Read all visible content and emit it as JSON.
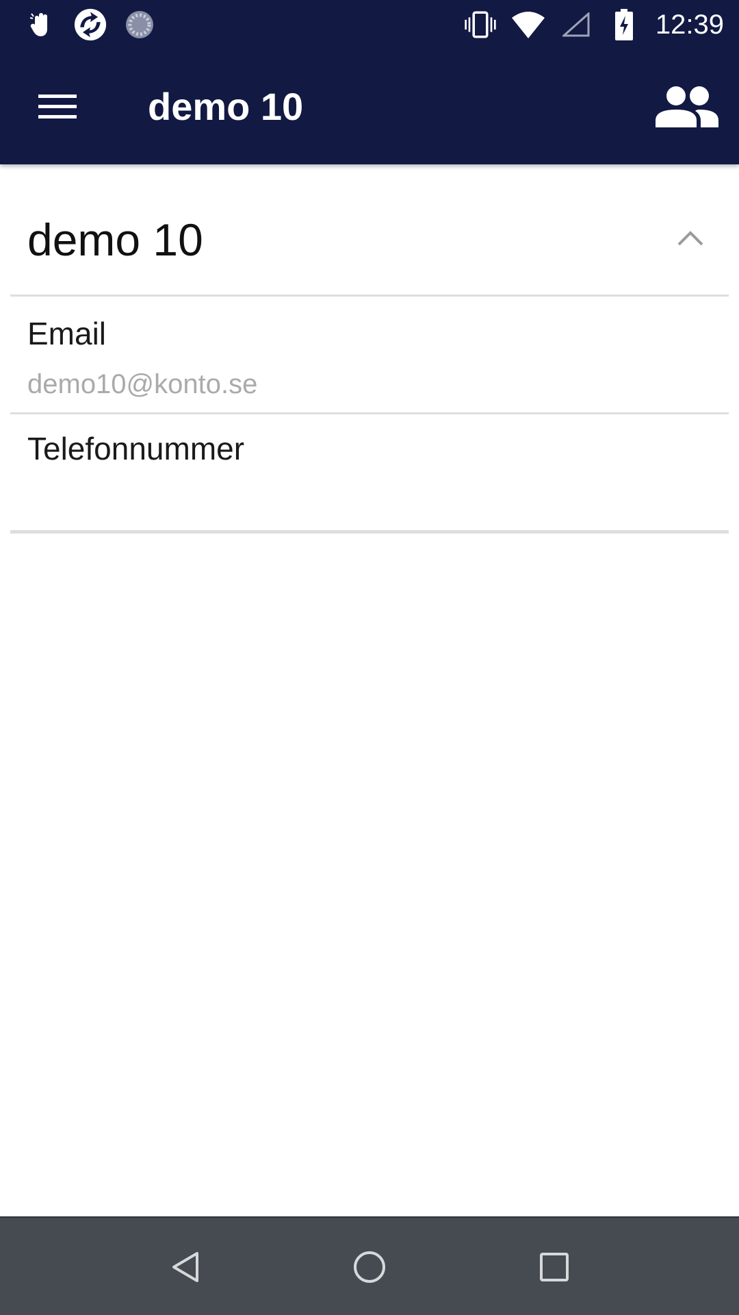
{
  "status_bar": {
    "time": "12:39",
    "left_icons": [
      "hand-wave-icon",
      "sync-app-icon",
      "loading-circle-icon"
    ],
    "right_icons": [
      "vibrate-icon",
      "wifi-icon",
      "cell-signal-icon",
      "battery-charging-icon"
    ]
  },
  "app_bar": {
    "title": "demo 10",
    "menu_icon": "hamburger-menu-icon",
    "action_icon": "people-icon",
    "background": "#121943"
  },
  "card": {
    "title": "demo 10",
    "collapse_icon": "chevron-up-icon",
    "fields": [
      {
        "label": "Email",
        "value": "demo10@konto.se"
      },
      {
        "label": "Telefonnummer",
        "value": ""
      }
    ]
  },
  "nav_bar": {
    "buttons": [
      "back-icon",
      "home-icon",
      "recents-icon"
    ],
    "background": "#454b51"
  }
}
